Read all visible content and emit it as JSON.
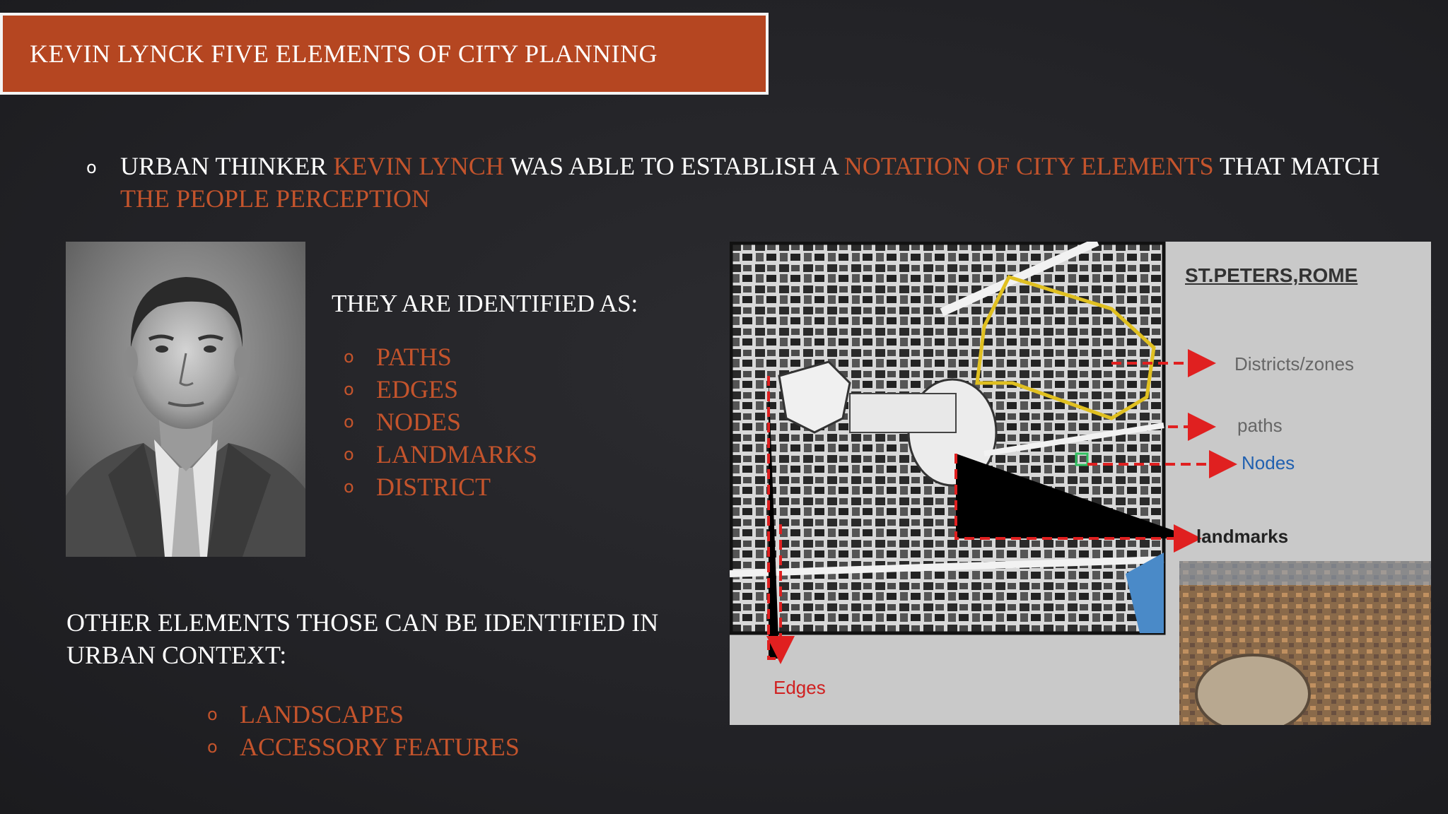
{
  "title": "KEVIN LYNCK FIVE ELEMENTS OF CITY PLANNING",
  "intro": {
    "segments": [
      {
        "text": "URBAN THINKER ",
        "accent": false
      },
      {
        "text": "KEVIN LYNCH",
        "accent": true
      },
      {
        "text": " WAS ABLE TO ESTABLISH A ",
        "accent": false
      },
      {
        "text": "NOTATION OF CITY ELEMENTS",
        "accent": true
      },
      {
        "text": " THAT MATCH ",
        "accent": false
      },
      {
        "text": "THE PEOPLE PERCEPTION",
        "accent": true
      }
    ]
  },
  "identified_heading": "THEY ARE IDENTIFIED AS:",
  "elements": [
    "PATHS",
    "EDGES",
    "NODES",
    "LANDMARKS",
    "DISTRICT"
  ],
  "other_heading": "OTHER ELEMENTS THOSE CAN BE IDENTIFIED IN URBAN CONTEXT:",
  "other_elements": [
    "LANDSCAPES",
    "ACCESSORY FEATURES"
  ],
  "bullet_glyph": "o",
  "map": {
    "title": "ST.PETERS,ROME",
    "labels": {
      "districts": "Districts/zones",
      "paths": "paths",
      "nodes": "Nodes",
      "landmarks": "landmarks",
      "edges": "Edges"
    }
  },
  "colors": {
    "accent": "#c4542c",
    "title_bar": "#b54621",
    "background": "#232327",
    "highlight_yellow": "#e0c020",
    "arrow_red": "#e02020",
    "node_green": "#30c060",
    "nodes_label_blue": "#2060b0"
  }
}
